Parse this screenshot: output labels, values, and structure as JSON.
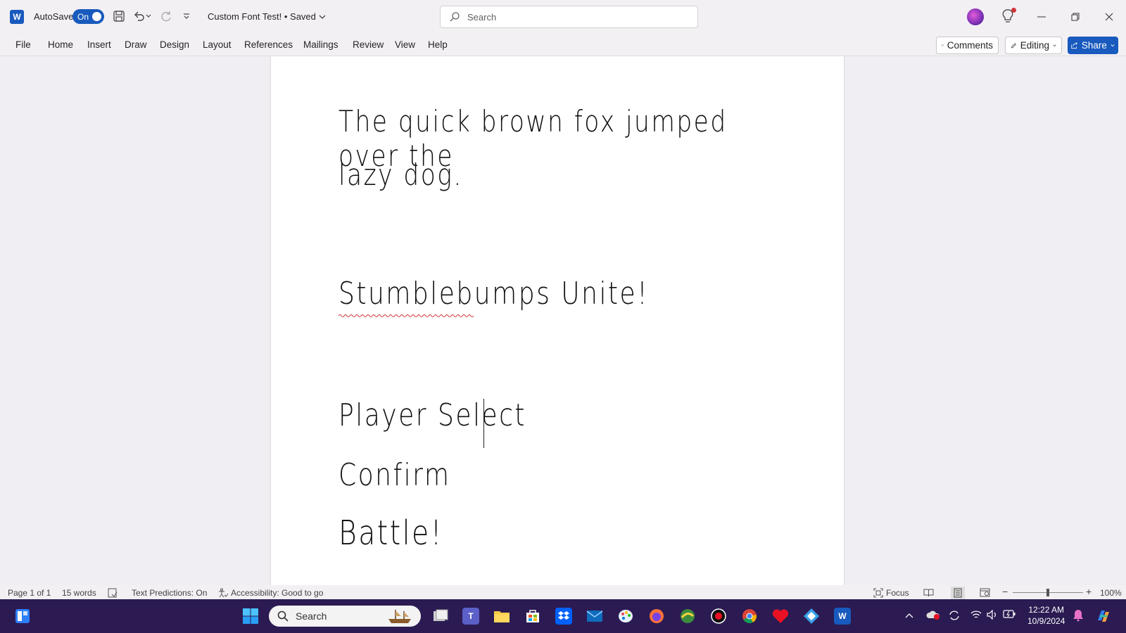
{
  "titlebar": {
    "autosave_label": "AutoSave",
    "autosave_state": "On",
    "doc_title": "Custom Font Test! • Saved",
    "search_placeholder": "Search"
  },
  "menu": {
    "items": [
      "File",
      "Home",
      "Insert",
      "Draw",
      "Design",
      "Layout",
      "References",
      "Mailings",
      "Review",
      "View",
      "Help"
    ],
    "comments_label": "Comments",
    "editing_label": "Editing",
    "share_label": "Share"
  },
  "document": {
    "lines": [
      "The quick brown fox jumped over the",
      "lazy dog.",
      "Stumblebumps Unite!",
      "Player Select",
      "Confirm",
      "Battle!"
    ]
  },
  "status": {
    "page": "Page 1 of 1",
    "words": "15 words",
    "text_predictions": "Text Predictions: On",
    "accessibility": "Accessibility: Good to go",
    "focus": "Focus",
    "zoom": "100%",
    "zoom_minus": "−",
    "zoom_plus": "+"
  },
  "taskbar": {
    "search_placeholder": "Search",
    "time": "12:22 AM",
    "date": "10/9/2024"
  },
  "colors": {
    "accent": "#185abd",
    "taskbar_bg": "#2b1b52",
    "spellcheck": "#d13438"
  }
}
